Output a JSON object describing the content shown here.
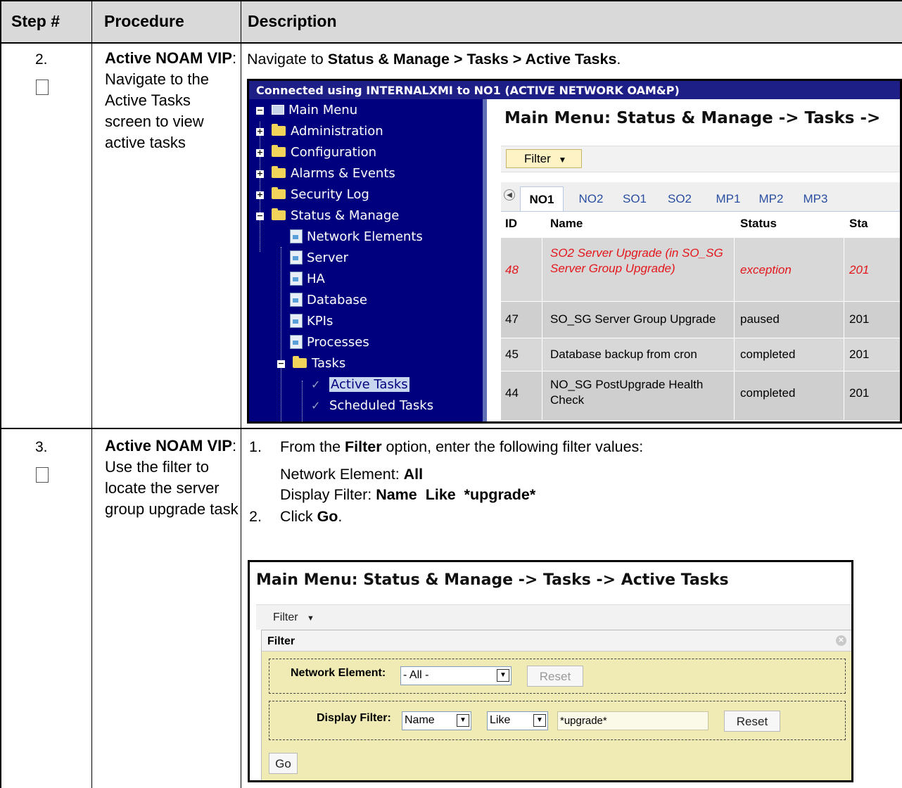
{
  "table": {
    "headers": {
      "step": "Step #",
      "procedure": "Procedure",
      "description": "Description"
    }
  },
  "steps": [
    {
      "number": "2.",
      "procedure_bold": "Active NOAM VIP",
      "procedure_text": ": Navigate to the Active Tasks screen to view active tasks",
      "description": {
        "prefix": "Navigate to ",
        "path": "Status & Manage > Tasks > Active Tasks",
        "suffix": "."
      }
    },
    {
      "number": "3.",
      "procedure_bold": "Active NOAM VIP",
      "procedure_text": ": Use the filter to locate the server group upgrade task",
      "description": {
        "item1_num": "1.",
        "item1_prefix": "From the ",
        "item1_bold": "Filter",
        "item1_suffix": " option, enter the following filter values:",
        "ne_label": "Network Element: ",
        "ne_value": "All",
        "df_label": "Display Filter: ",
        "df_value": "Name  Like  *upgrade*",
        "item2_num": "2.",
        "item2_prefix": "Click ",
        "item2_bold": "Go",
        "item2_suffix": "."
      }
    }
  ],
  "screenshot1": {
    "banner": "Connected using INTERNALXMI to NO1 (ACTIVE NETWORK OAM&P)",
    "menu": {
      "root": "Main Menu",
      "items": [
        "Administration",
        "Configuration",
        "Alarms & Events",
        "Security Log",
        "Status & Manage"
      ],
      "status_children": [
        "Network Elements",
        "Server",
        "HA",
        "Database",
        "KPIs",
        "Processes",
        "Tasks"
      ],
      "task_children": [
        "Active Tasks",
        "Scheduled Tasks"
      ]
    },
    "title": "Main Menu: Status & Manage -> Tasks ->",
    "filter_label": "Filter",
    "tabs": [
      "NO1",
      "NO2",
      "SO1",
      "SO2",
      "MP1",
      "MP2",
      "MP3"
    ],
    "columns": [
      "ID",
      "Name",
      "Status",
      "Sta"
    ],
    "rows": [
      {
        "id": "48",
        "name": "SO2 Server Upgrade (in SO_SG Server Group Upgrade)",
        "status": "exception",
        "start": "201"
      },
      {
        "id": "47",
        "name": "SO_SG Server Group Upgrade",
        "status": "paused",
        "start": "201"
      },
      {
        "id": "45",
        "name": "Database backup from cron",
        "status": "completed",
        "start": "201"
      },
      {
        "id": "44",
        "name": "NO_SG PostUpgrade Health Check",
        "status": "completed",
        "start": "201"
      }
    ],
    "colors": {
      "banner": "#1d1e86",
      "sidebar": "#00007e",
      "error_text": "#e3161b"
    }
  },
  "screenshot2": {
    "title": "Main Menu: Status & Manage -> Tasks -> Active Tasks",
    "filter_label": "Filter",
    "panel_title": "Filter",
    "network_element": {
      "label": "Network Element:",
      "value": "- All -",
      "reset": "Reset"
    },
    "display_filter": {
      "label": "Display Filter:",
      "field": "Name",
      "operator": "Like",
      "value": "*upgrade*",
      "reset": "Reset"
    },
    "go": "Go"
  }
}
